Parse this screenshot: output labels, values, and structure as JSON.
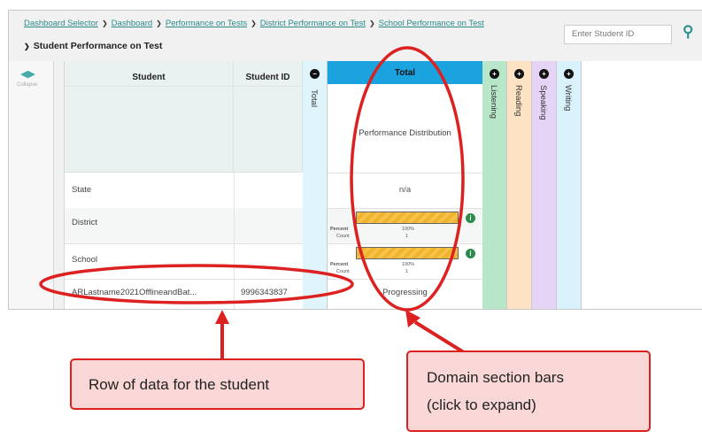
{
  "breadcrumbs": [
    "Dashboard Selector",
    "Dashboard",
    "Performance on Tests",
    "District Performance on Test",
    "School Performance on Test"
  ],
  "current_page": "Student Performance on Test",
  "search": {
    "placeholder": "Enter Student ID"
  },
  "leftbar": {
    "collapse_label": "Collapse"
  },
  "table": {
    "headers": {
      "student": "Student",
      "student_id": "Student ID",
      "total_vertical": "Total",
      "total": "Total"
    },
    "perf_distribution": "Performance Distribution",
    "domains": [
      "Listening",
      "Reading",
      "Speaking",
      "Writing"
    ],
    "rows": {
      "state": {
        "label": "State",
        "value": "n/a"
      },
      "district": {
        "label": "District",
        "percent_label": "Percent",
        "count_label": "Count",
        "percent": "100%",
        "count": "1"
      },
      "school": {
        "label": "School",
        "percent_label": "Percent",
        "count_label": "Count",
        "percent": "100%",
        "count": "1"
      },
      "student": {
        "name": "ARLastname2021OfflineandBat...",
        "id": "9996343837",
        "status": "Progressing"
      }
    }
  },
  "callouts": {
    "row": "Row of data for the student",
    "domain_line1": "Domain section bars",
    "domain_line2": "(click to expand)"
  },
  "colors": {
    "total_header": "#1aa3df",
    "total_column": "#dff4fb",
    "listening": "#b8e6c9",
    "reading": "#fde2c3",
    "speaking": "#e6d4f7",
    "writing": "#d8f1fb",
    "annotation_red": "#dd2020",
    "callout_fill": "#f8d7d6",
    "bar_fill": "#f7c24a"
  }
}
